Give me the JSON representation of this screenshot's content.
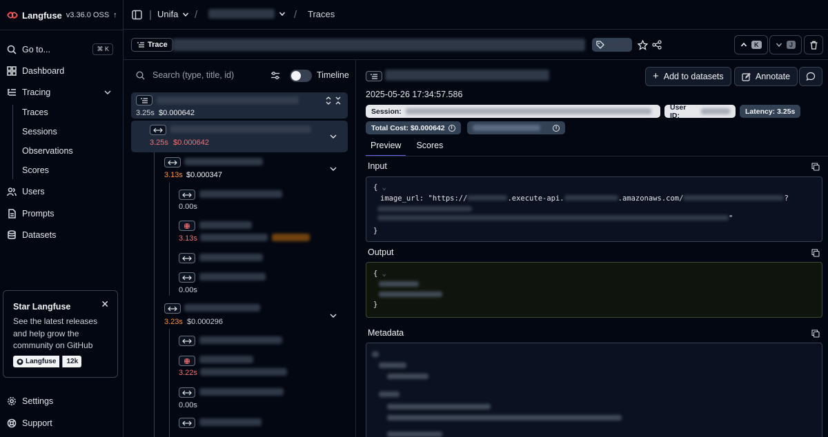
{
  "app": {
    "name": "Langfuse",
    "version": "v3.36.0 OSS",
    "update_icon": "arrow-up-icon"
  },
  "sidebar": {
    "goto_label": "Go to...",
    "goto_shortcut": "⌘ K",
    "items": [
      {
        "label": "Dashboard",
        "icon": "grid-icon"
      },
      {
        "label": "Tracing",
        "icon": "tracing-icon"
      },
      {
        "label": "Users",
        "icon": "users-icon"
      },
      {
        "label": "Prompts",
        "icon": "file-icon"
      },
      {
        "label": "Datasets",
        "icon": "database-icon"
      }
    ],
    "tracing_sub": [
      "Traces",
      "Sessions",
      "Observations",
      "Scores"
    ],
    "bottom": [
      {
        "label": "Settings",
        "icon": "gear-icon"
      },
      {
        "label": "Support",
        "icon": "lifebuoy-icon"
      }
    ]
  },
  "star_card": {
    "title": "Star Langfuse",
    "description": "See the latest releases and help grow the community on GitHub",
    "gh_label": "Langfuse",
    "gh_count": "12k"
  },
  "breadcrumb": {
    "org": "Unifa",
    "page": "Traces"
  },
  "trace_header": {
    "badge": "Trace"
  },
  "tree": {
    "search_placeholder": "Search (type, title, id)",
    "timeline_label": "Timeline",
    "nodes": [
      {
        "duration": "3.25s",
        "cost": "$0.000642"
      },
      {
        "duration": "3.25s",
        "cost": "$0.000642"
      },
      {
        "duration": "3.13s",
        "cost": "$0.000347"
      },
      {
        "duration": "0.00s"
      },
      {
        "duration": "3.13s"
      },
      {
        "duration": "0.00s"
      },
      {
        "duration": "3.23s",
        "cost": "$0.000296"
      },
      {
        "duration": "3.22s"
      },
      {
        "duration": "0.00s"
      }
    ]
  },
  "detail": {
    "add_to_datasets": "Add to datasets",
    "annotate": "Annotate",
    "timestamp": "2025-05-26 17:34:57.586",
    "session_label": "Session:",
    "user_label": "User ID:",
    "latency": "Latency: 3.25s",
    "total_cost": "Total Cost: $0.000642",
    "tabs": [
      "Preview",
      "Scores"
    ],
    "input_title": "Input",
    "output_title": "Output",
    "metadata_title": "Metadata",
    "input_code": {
      "open": "{",
      "key": "image_url: \"https://",
      "part1": ".execute-api.",
      "part2": ".amazonaws.com/",
      "part3": "?",
      "end_quote": "\"",
      "close": "}"
    },
    "output_code": {
      "open": "{",
      "close": "}"
    }
  },
  "colors": {
    "background": "#030712",
    "accent": "#6366f1",
    "duration_red": "#f87171",
    "output_bg": "#0f150c"
  }
}
